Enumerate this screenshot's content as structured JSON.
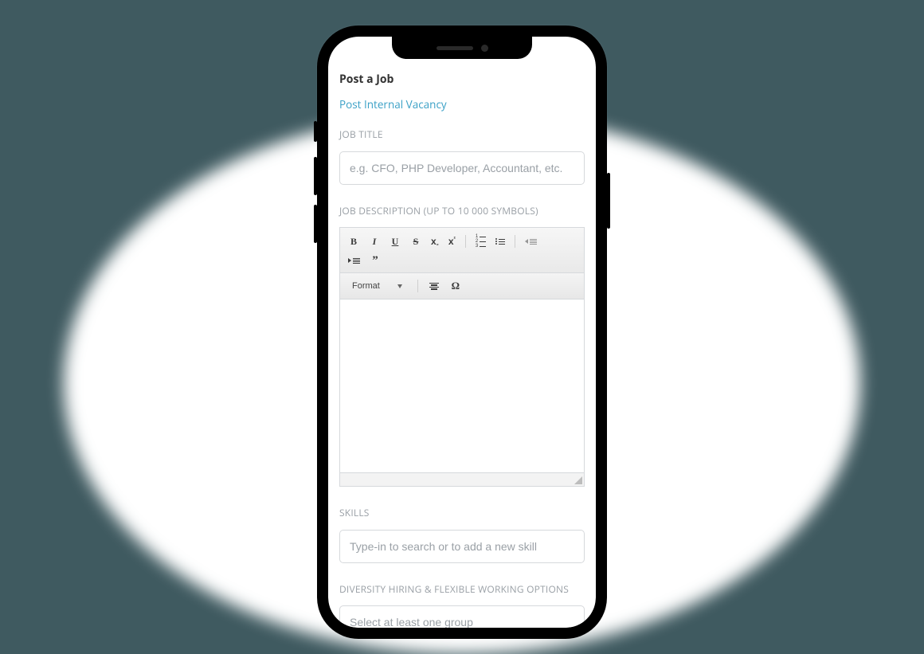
{
  "page": {
    "title": "Post a Job",
    "vacancy_link": "Post Internal Vacancy"
  },
  "form": {
    "job_title": {
      "label": "JOB TITLE",
      "placeholder": "e.g. CFO, PHP Developer, Accountant, etc."
    },
    "job_description": {
      "label": "JOB DESCRIPTION (UP TO 10 000 SYMBOLS)",
      "format_label": "Format"
    },
    "skills": {
      "label": "SKILLS",
      "placeholder": "Type-in to search or to add a new skill"
    },
    "diversity": {
      "label": "DIVERSITY HIRING & FLEXIBLE WORKING OPTIONS",
      "placeholder": "Select at least one group"
    }
  }
}
